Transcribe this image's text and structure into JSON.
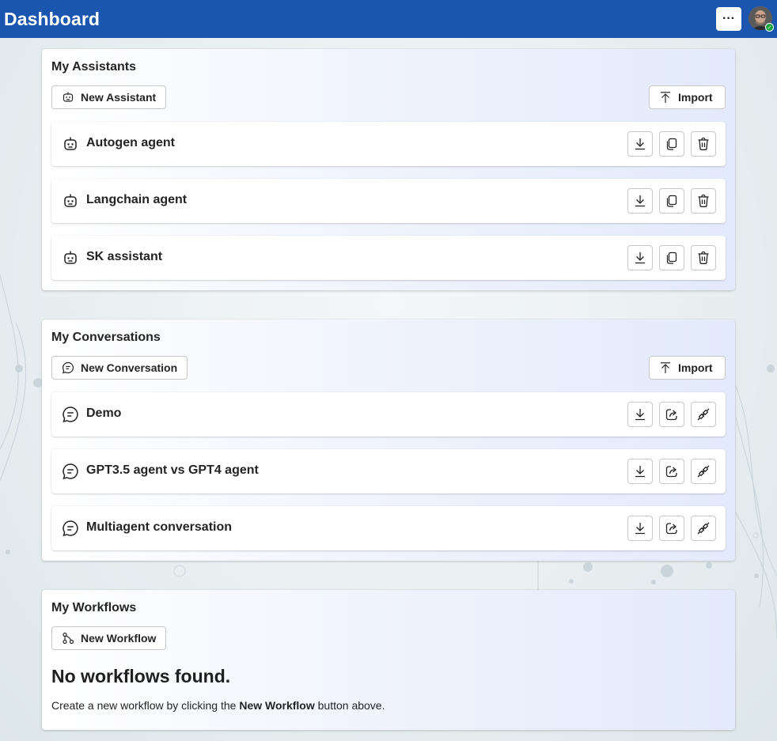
{
  "header": {
    "title": "Dashboard",
    "more_label": "···",
    "more_icon": "more-horizontal-icon",
    "avatar_icon": "user-avatar",
    "presence_status": "available"
  },
  "assistants": {
    "title": "My Assistants",
    "new_label": "New Assistant",
    "import_label": "Import",
    "items": [
      {
        "label": "Autogen agent"
      },
      {
        "label": "Langchain agent"
      },
      {
        "label": "SK assistant"
      }
    ],
    "item_actions": [
      "download-icon",
      "copy-icon",
      "delete-icon"
    ]
  },
  "conversations": {
    "title": "My Conversations",
    "new_label": "New Conversation",
    "import_label": "Import",
    "items": [
      {
        "label": "Demo"
      },
      {
        "label": "GPT3.5 agent vs GPT4 agent"
      },
      {
        "label": "Multiagent conversation"
      }
    ],
    "item_actions": [
      "download-icon",
      "share-icon",
      "plug-connected-icon"
    ]
  },
  "workflows": {
    "title": "My Workflows",
    "new_label": "New Workflow",
    "empty_title": "No workflows found.",
    "empty_text_before": "Create a new workflow by clicking the ",
    "empty_text_bold": "New Workflow",
    "empty_text_after": " button above."
  },
  "colors": {
    "header_bg": "#1a56b0",
    "presence": "#12a33b"
  }
}
